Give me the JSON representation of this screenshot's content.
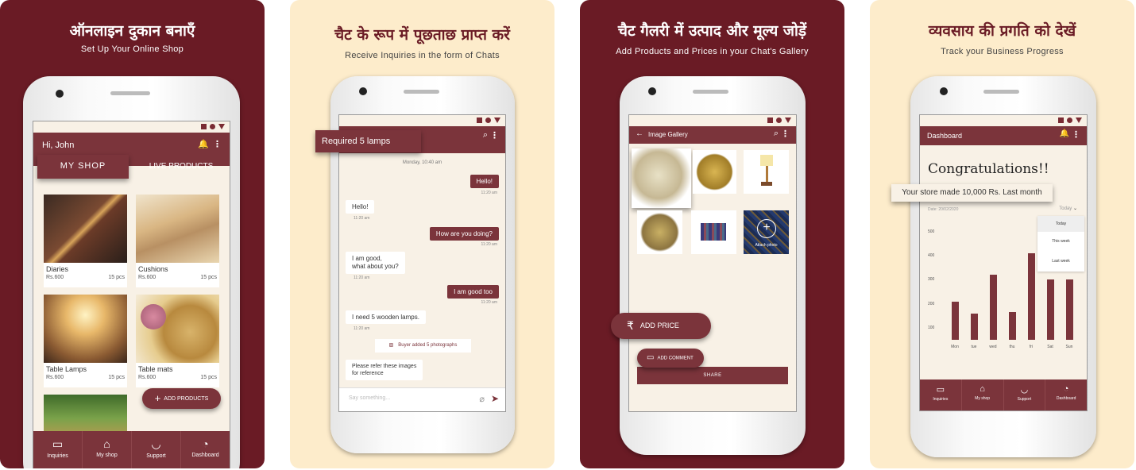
{
  "colors": {
    "maroon": "#6a1b25",
    "cream": "#fdeccb",
    "accent": "#7b343b"
  },
  "panel1": {
    "title": "ऑनलाइन दुकान बनाएँ",
    "subtitle": "Set Up Your Online Shop",
    "greeting": "Hi, John",
    "tab_myshop": "MY SHOP",
    "tab_live": "LIVE PRODUCTS",
    "products": [
      {
        "name": "Diaries",
        "price": "Rs.600",
        "qty": "15 pcs"
      },
      {
        "name": "Cushions",
        "price": "Rs.600",
        "qty": "15 pcs"
      },
      {
        "name": "Table Lamps",
        "price": "Rs.600",
        "qty": "15 pcs"
      },
      {
        "name": "Table mats",
        "price": "Rs.600",
        "qty": "15 pcs"
      }
    ],
    "add_products": "ADD PRODUCTS"
  },
  "nav": {
    "inquiries": "Inquiries",
    "myshop": "My shop",
    "support": "Support",
    "dashboard": "Dashboard"
  },
  "panel2": {
    "title": "चैट के रूप में पूछताछ प्राप्त करें",
    "subtitle": "Receive Inquiries in the form of Chats",
    "callout": "Required 5 lamps",
    "date": "Monday, 10:40 am",
    "messages": [
      {
        "text": "Hello!",
        "time": "11:20 am"
      },
      {
        "text": "Hello!",
        "time": "11:20 am"
      },
      {
        "text": "How are you doing?",
        "time": "11:20 am"
      },
      {
        "text": "I am good,",
        "text2": "what about you?",
        "time": "11:20 am"
      },
      {
        "text": "I am good too",
        "time": "11:20 am"
      },
      {
        "text": "I need 5 wooden lamps.",
        "time": "11:20 am"
      },
      {
        "text": "Buyer added 5 photographs"
      },
      {
        "text": "Please refer these images",
        "text2": "for reference"
      }
    ],
    "placeholder": "Say something..."
  },
  "panel3": {
    "title": "चैट गैलरी में उत्पाद और मूल्य जोड़ें",
    "subtitle": "Add Products and Prices in your Chat's Gallery",
    "header": "Image Gallery",
    "attach": "Attach photo",
    "add_price": "ADD PRICE",
    "add_comment": "ADD COMMENT",
    "share": "SHARE"
  },
  "panel4": {
    "title": "व्यवसाय की प्रगति को देखें",
    "subtitle": "Track your Business Progress",
    "header": "Dashboard",
    "congrats": "Congratulations!!",
    "callout": "Your store made 10,000 Rs. Last month",
    "date": "Date: 20/02/2020",
    "dropdown": "Today",
    "options": [
      "Today",
      "This week",
      "Last week"
    ],
    "chart_data": {
      "type": "bar",
      "categories": [
        "Mon",
        "tue",
        "wed",
        "thu",
        "fri",
        "Sat",
        "Sun"
      ],
      "values": [
        210,
        160,
        320,
        165,
        410,
        300,
        300
      ],
      "yticks": [
        "500",
        "400",
        "300",
        "200",
        "100"
      ],
      "ylim": [
        50,
        530
      ]
    }
  }
}
